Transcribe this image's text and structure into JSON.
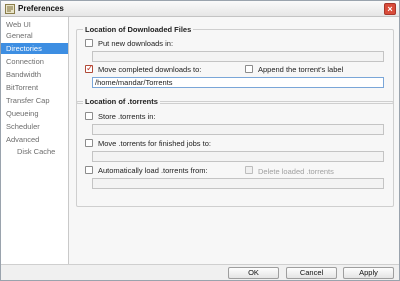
{
  "window": {
    "title": "Preferences"
  },
  "sidebar": {
    "items": [
      {
        "label": "Web UI"
      },
      {
        "label": "General"
      },
      {
        "label": "Directories"
      },
      {
        "label": "Connection"
      },
      {
        "label": "Bandwidth"
      },
      {
        "label": "BitTorrent"
      },
      {
        "label": "Transfer Cap"
      },
      {
        "label": "Queueing"
      },
      {
        "label": "Scheduler"
      },
      {
        "label": "Advanced"
      },
      {
        "label": "Disk Cache"
      }
    ],
    "selected": "Directories"
  },
  "downloaded": {
    "title": "Location of Downloaded Files",
    "put_new_label": "Put new downloads in:",
    "put_new_checked": false,
    "put_new_value": "",
    "move_completed_label": "Move completed downloads to:",
    "move_completed_checked": true,
    "append_label": "Append the torrent's label",
    "append_checked": false,
    "move_completed_value": "/home/mandar/Torrents"
  },
  "torrents": {
    "title": "Location of .torrents",
    "store_label": "Store .torrents in:",
    "store_checked": false,
    "store_value": "",
    "move_finished_label": "Move .torrents for finished jobs to:",
    "move_finished_checked": false,
    "move_finished_value": "",
    "autoload_label": "Automatically load .torrents from:",
    "autoload_checked": false,
    "delete_loaded_label": "Delete loaded .torrents",
    "delete_loaded_checked": false,
    "autoload_value": ""
  },
  "footer": {
    "ok": "OK",
    "cancel": "Cancel",
    "apply": "Apply"
  },
  "colors": {
    "accent": "#3d8ee2",
    "check": "#c0392b",
    "close": "#d94c3a"
  }
}
